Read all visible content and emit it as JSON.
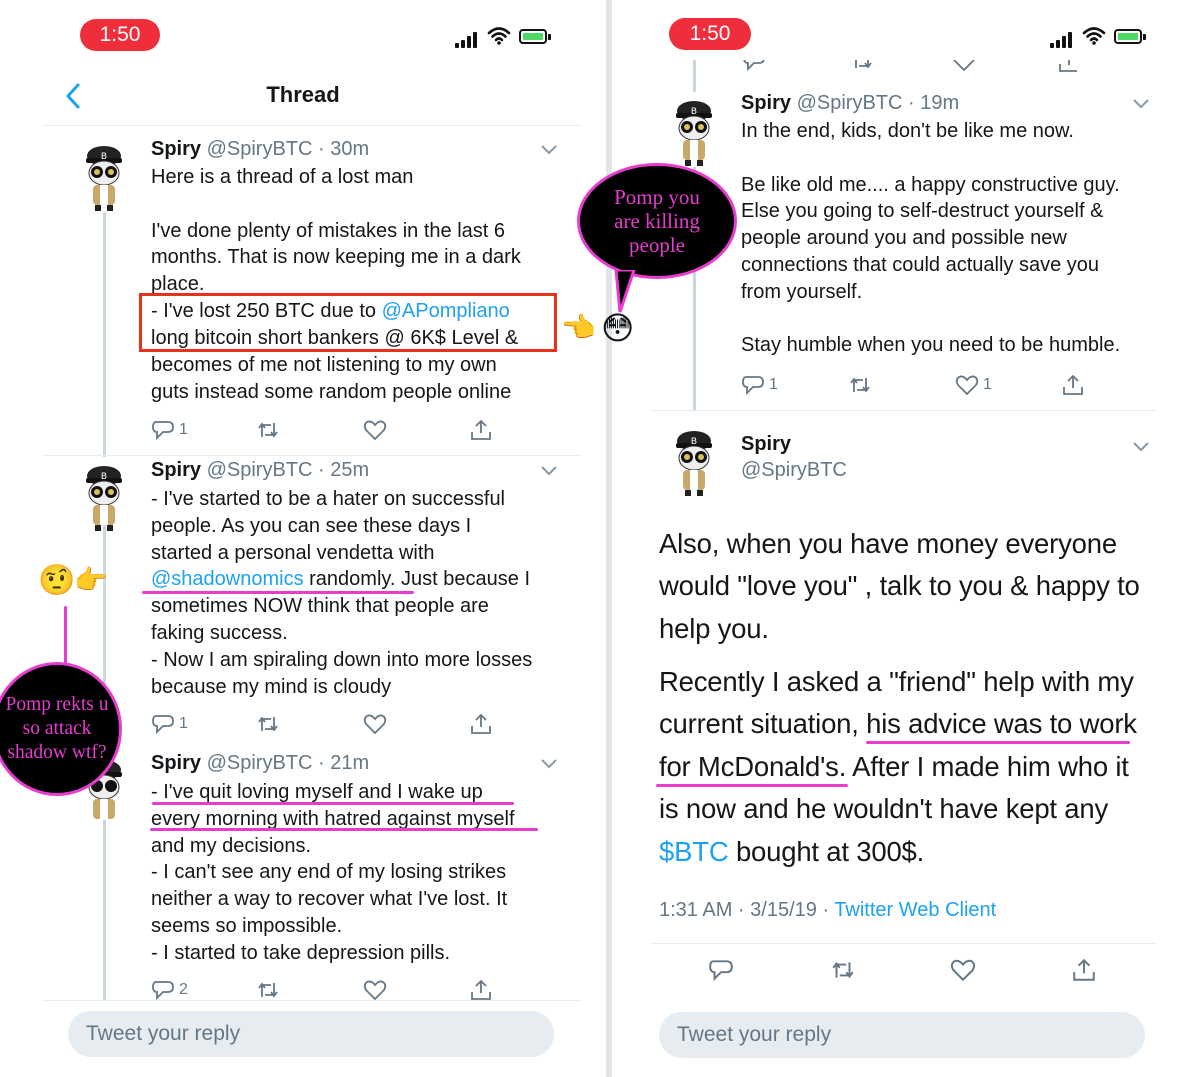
{
  "left": {
    "status_time": "1:50",
    "header_title": "Thread",
    "tweets": [
      {
        "name": "Spiry",
        "handle": "@SpiryBTC",
        "time": "30m",
        "text_before_box": "Here is a thread of a lost man\n\nI've done plenty of mistakes in the last 6\nmonths. That is now keeping me in a dark\nplace.",
        "boxed_prefix": "- I've lost 250 BTC due to ",
        "boxed_mention": "@APompliano",
        "boxed_rest": "long bitcoin short bankers @ 6K$ Level &",
        "text_after_box": "becomes of me not listening to my own\nguts instead some random people online",
        "reply_count": "1",
        "retweet_count": "",
        "like_count": ""
      },
      {
        "name": "Spiry",
        "handle": "@SpiryBTC",
        "time": "25m",
        "text_a": "- I've started to be a hater on successful\npeople. As you can see these days I\nstarted a personal vendetta with\n",
        "mention": "@shadownomics",
        "text_b": " randomly. Just because I\nsometimes NOW think that people are\nfaking success.\n- Now I am spiraling down into more losses\nbecause my mind is cloudy",
        "reply_count": "1",
        "retweet_count": "",
        "like_count": ""
      },
      {
        "name": "Spiry",
        "handle": "@SpiryBTC",
        "time": "21m",
        "text": "- I've quit loving myself and I wake up\nevery morning with hatred against myself\nand my decisions.\n- I can't see any end of my losing strikes\nneither a way to recover what I've lost. It\nseems so impossible.\n- I started to take depression pills.",
        "reply_count": "2",
        "retweet_count": "",
        "like_count": ""
      }
    ],
    "reply_placeholder": "Tweet your reply",
    "annotation_bubble_left": "Pomp rekts u\nso attack\nshadow wtf?",
    "emoji_thinking": "🤨",
    "emoji_point_right": "👉"
  },
  "right": {
    "status_time": "1:50",
    "tweet_top": {
      "name": "Spiry",
      "handle": "@SpiryBTC",
      "time": "19m",
      "text": "In the end, kids, don't be like me now.\n\nBe like old me.... a happy constructive guy.\nElse you going to self-destruct yourself &\npeople around you and possible new\nconnections that could actually save you\nfrom yourself.\n\nStay humble when you need to be humble.",
      "reply_count": "1",
      "retweet_count": "",
      "like_count": "1"
    },
    "main_tweet": {
      "name": "Spiry",
      "handle": "@SpiryBTC",
      "para1": "Also, when you have money everyone\nwould \"love you\" , talk to you & happy to\nhelp you.",
      "para2_a": "Recently I asked a \"friend\" help with my\ncurrent situation, his advice was to work\nfor McDonald's. After I made him who it\nis now and he wouldn't have kept any\n",
      "cashtag": "$BTC",
      "para2_b": " bought at 300$.",
      "timestamp": "1:31 AM · 3/15/19 · ",
      "client": "Twitter Web Client"
    },
    "reply_placeholder": "Tweet your reply",
    "annotation_bubble_right": "Pomp you\nare killing\npeople",
    "emoji_point_left": "👈",
    "emoji_flushed": "😳"
  },
  "colors": {
    "link": "#1da1f2",
    "annotation_pink": "#e63ccf",
    "annotation_red": "#e8301c",
    "status_pill": "#f02d3a"
  }
}
